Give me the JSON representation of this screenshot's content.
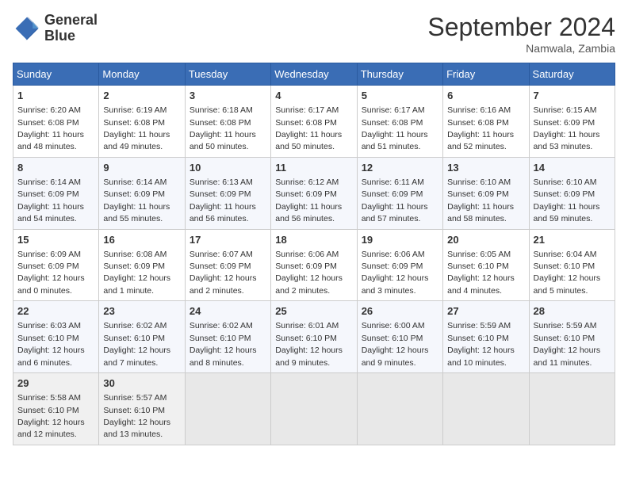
{
  "header": {
    "logo_line1": "General",
    "logo_line2": "Blue",
    "month_year": "September 2024",
    "location": "Namwala, Zambia"
  },
  "weekdays": [
    "Sunday",
    "Monday",
    "Tuesday",
    "Wednesday",
    "Thursday",
    "Friday",
    "Saturday"
  ],
  "weeks": [
    [
      {
        "day": "1",
        "sunrise": "6:20 AM",
        "sunset": "6:08 PM",
        "daylight": "11 hours and 48 minutes."
      },
      {
        "day": "2",
        "sunrise": "6:19 AM",
        "sunset": "6:08 PM",
        "daylight": "11 hours and 49 minutes."
      },
      {
        "day": "3",
        "sunrise": "6:18 AM",
        "sunset": "6:08 PM",
        "daylight": "11 hours and 50 minutes."
      },
      {
        "day": "4",
        "sunrise": "6:17 AM",
        "sunset": "6:08 PM",
        "daylight": "11 hours and 50 minutes."
      },
      {
        "day": "5",
        "sunrise": "6:17 AM",
        "sunset": "6:08 PM",
        "daylight": "11 hours and 51 minutes."
      },
      {
        "day": "6",
        "sunrise": "6:16 AM",
        "sunset": "6:08 PM",
        "daylight": "11 hours and 52 minutes."
      },
      {
        "day": "7",
        "sunrise": "6:15 AM",
        "sunset": "6:09 PM",
        "daylight": "11 hours and 53 minutes."
      }
    ],
    [
      {
        "day": "8",
        "sunrise": "6:14 AM",
        "sunset": "6:09 PM",
        "daylight": "11 hours and 54 minutes."
      },
      {
        "day": "9",
        "sunrise": "6:14 AM",
        "sunset": "6:09 PM",
        "daylight": "11 hours and 55 minutes."
      },
      {
        "day": "10",
        "sunrise": "6:13 AM",
        "sunset": "6:09 PM",
        "daylight": "11 hours and 56 minutes."
      },
      {
        "day": "11",
        "sunrise": "6:12 AM",
        "sunset": "6:09 PM",
        "daylight": "11 hours and 56 minutes."
      },
      {
        "day": "12",
        "sunrise": "6:11 AM",
        "sunset": "6:09 PM",
        "daylight": "11 hours and 57 minutes."
      },
      {
        "day": "13",
        "sunrise": "6:10 AM",
        "sunset": "6:09 PM",
        "daylight": "11 hours and 58 minutes."
      },
      {
        "day": "14",
        "sunrise": "6:10 AM",
        "sunset": "6:09 PM",
        "daylight": "11 hours and 59 minutes."
      }
    ],
    [
      {
        "day": "15",
        "sunrise": "6:09 AM",
        "sunset": "6:09 PM",
        "daylight": "12 hours and 0 minutes."
      },
      {
        "day": "16",
        "sunrise": "6:08 AM",
        "sunset": "6:09 PM",
        "daylight": "12 hours and 1 minute."
      },
      {
        "day": "17",
        "sunrise": "6:07 AM",
        "sunset": "6:09 PM",
        "daylight": "12 hours and 2 minutes."
      },
      {
        "day": "18",
        "sunrise": "6:06 AM",
        "sunset": "6:09 PM",
        "daylight": "12 hours and 2 minutes."
      },
      {
        "day": "19",
        "sunrise": "6:06 AM",
        "sunset": "6:09 PM",
        "daylight": "12 hours and 3 minutes."
      },
      {
        "day": "20",
        "sunrise": "6:05 AM",
        "sunset": "6:10 PM",
        "daylight": "12 hours and 4 minutes."
      },
      {
        "day": "21",
        "sunrise": "6:04 AM",
        "sunset": "6:10 PM",
        "daylight": "12 hours and 5 minutes."
      }
    ],
    [
      {
        "day": "22",
        "sunrise": "6:03 AM",
        "sunset": "6:10 PM",
        "daylight": "12 hours and 6 minutes."
      },
      {
        "day": "23",
        "sunrise": "6:02 AM",
        "sunset": "6:10 PM",
        "daylight": "12 hours and 7 minutes."
      },
      {
        "day": "24",
        "sunrise": "6:02 AM",
        "sunset": "6:10 PM",
        "daylight": "12 hours and 8 minutes."
      },
      {
        "day": "25",
        "sunrise": "6:01 AM",
        "sunset": "6:10 PM",
        "daylight": "12 hours and 9 minutes."
      },
      {
        "day": "26",
        "sunrise": "6:00 AM",
        "sunset": "6:10 PM",
        "daylight": "12 hours and 9 minutes."
      },
      {
        "day": "27",
        "sunrise": "5:59 AM",
        "sunset": "6:10 PM",
        "daylight": "12 hours and 10 minutes."
      },
      {
        "day": "28",
        "sunrise": "5:59 AM",
        "sunset": "6:10 PM",
        "daylight": "12 hours and 11 minutes."
      }
    ],
    [
      {
        "day": "29",
        "sunrise": "5:58 AM",
        "sunset": "6:10 PM",
        "daylight": "12 hours and 12 minutes."
      },
      {
        "day": "30",
        "sunrise": "5:57 AM",
        "sunset": "6:10 PM",
        "daylight": "12 hours and 13 minutes."
      },
      null,
      null,
      null,
      null,
      null
    ]
  ]
}
